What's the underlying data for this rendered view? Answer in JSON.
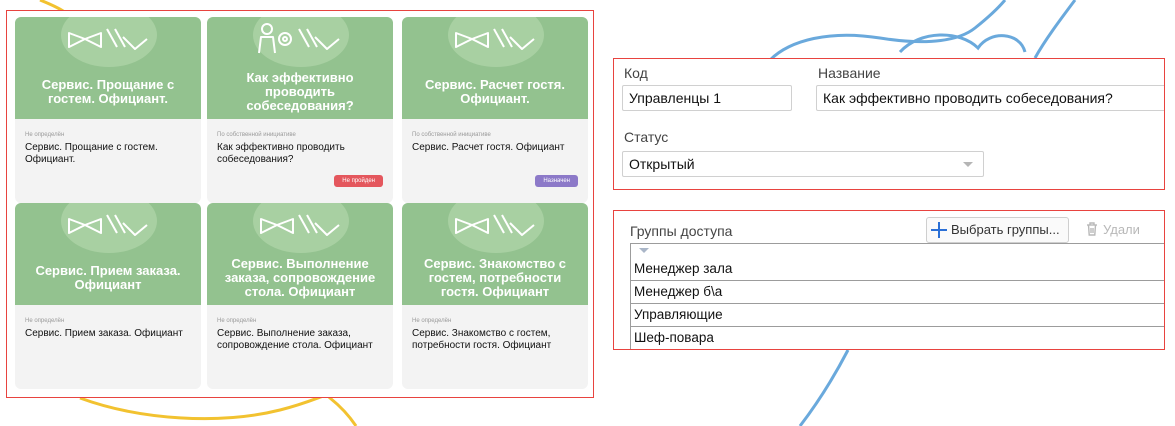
{
  "cards": [
    {
      "title": "Сервис. Прощание с гостем. Официант.",
      "meta": "Не определён",
      "name": "Сервис. Прощание с гостем. Официант.",
      "icon": "bowtie-icon",
      "badge": null
    },
    {
      "title": "Как эффективно проводить собеседования?",
      "meta": "По собственной инициативе",
      "name": "Как эффективно проводить собеседования?",
      "icon": "person-gear-icon",
      "badge": {
        "label": "Не пройден",
        "color": "#e4575d"
      }
    },
    {
      "title": "Сервис. Расчет гостя. Официант.",
      "meta": "По собственной инициативе",
      "name": "Сервис. Расчет гостя. Официант",
      "icon": "bowtie-icon",
      "badge": {
        "label": "Назначен",
        "color": "#8c79c8"
      }
    },
    {
      "title": "Сервис. Прием заказа. Официант",
      "meta": "Не определён",
      "name": "Сервис. Прием заказа. Официант",
      "icon": "bowtie-icon",
      "badge": null
    },
    {
      "title": "Сервис. Выполнение заказа, сопровождение стола. Официант",
      "meta": "Не определён",
      "name": "Сервис. Выполнение заказа, сопровождение стола. Официант",
      "icon": "bowtie-icon",
      "badge": null
    },
    {
      "title": "Сервис. Знакомство с гостем, потребности гостя. Официант",
      "meta": "Не определён",
      "name": "Сервис. Знакомство с гостем, потребности гостя. Официант",
      "icon": "bowtie-icon",
      "badge": null
    }
  ],
  "form": {
    "code_label": "Код",
    "code_value": "Управленцы 1",
    "name_label": "Название",
    "name_value": "Как эффективно проводить собеседования?",
    "status_label": "Статус",
    "status_value": "Открытый"
  },
  "groups": {
    "label": "Группы доступа",
    "select_button": "Выбрать группы...",
    "delete_button": "Удали",
    "rows": [
      "Менеджер зала",
      "Менеджер б\\а",
      "Управляющие",
      "Шеф-повара"
    ]
  },
  "colors": {
    "card_green": "#93c28f",
    "highlight_border": "#e8433f",
    "decor_yellow": "#f2c230",
    "decor_blue": "#6aa9dc"
  }
}
